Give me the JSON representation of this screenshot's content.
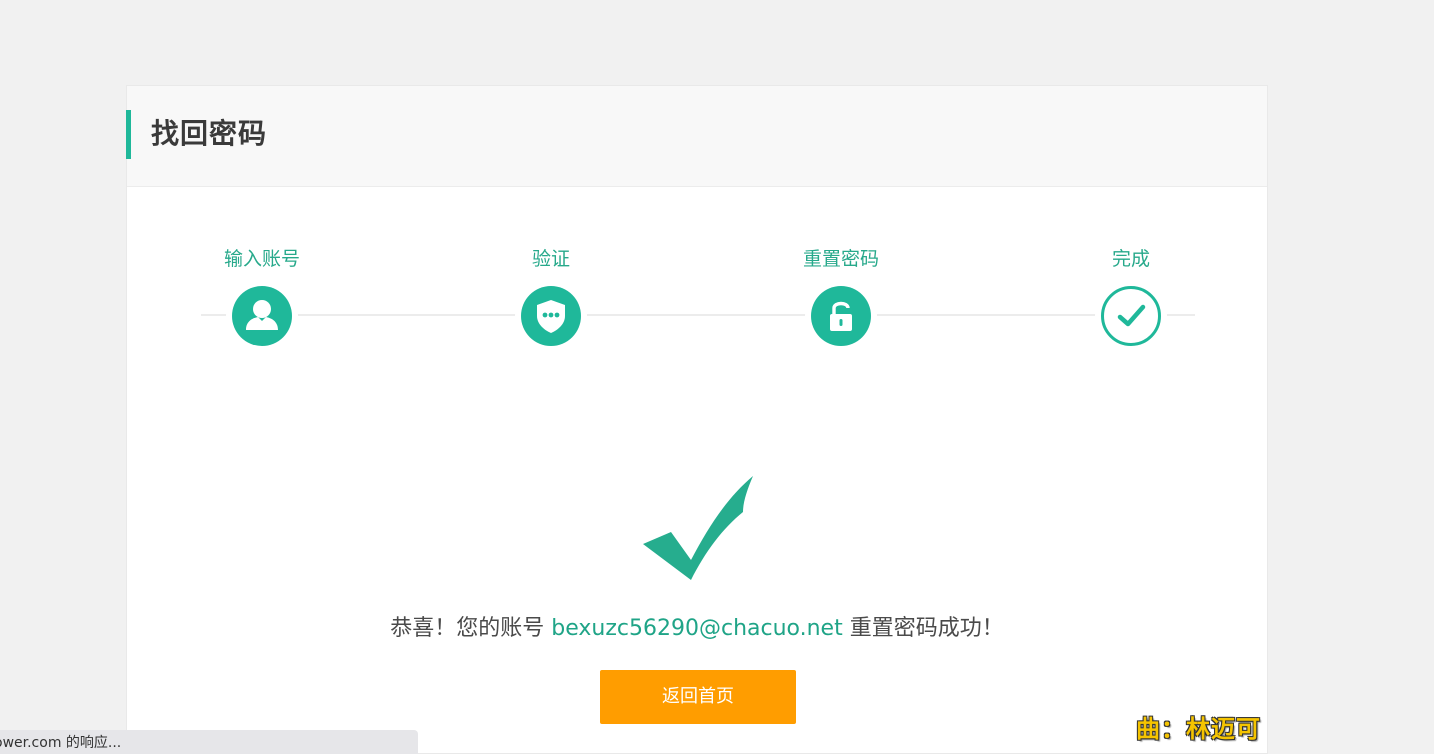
{
  "header": {
    "title": "找回密码"
  },
  "steps": [
    {
      "label": "输入账号",
      "icon": "user-icon"
    },
    {
      "label": "验证",
      "icon": "shield-message-icon"
    },
    {
      "label": "重置密码",
      "icon": "unlock-icon"
    },
    {
      "label": "完成",
      "icon": "check-circle-icon"
    }
  ],
  "result": {
    "prefix": "恭喜！您的账号 ",
    "account": "bexuzc56290@chacuo.net",
    "suffix": " 重置密码成功！",
    "button_label": "返回首页"
  },
  "status_bar": {
    "text": "ower.com 的响应..."
  },
  "overlay": {
    "song_credit": "曲：林迈可"
  },
  "colors": {
    "accent": "#1fb89a",
    "button": "#ff9d00",
    "background": "#f1f1f1"
  }
}
